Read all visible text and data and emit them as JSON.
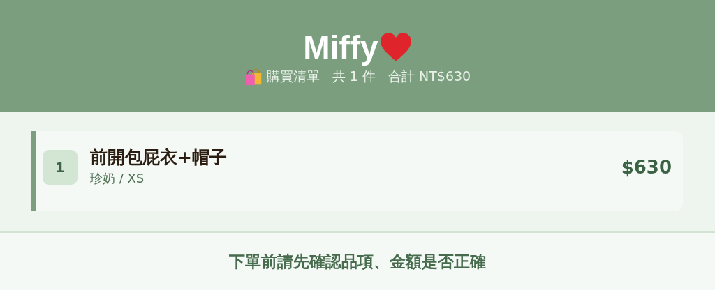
{
  "header": {
    "title": "Miffy",
    "list_label": "購買清單",
    "count": "共 1 件",
    "total": "合計 NT$630"
  },
  "items": [
    {
      "index": "1",
      "name": "前開包屁衣+帽子",
      "variant": "珍奶 / XS",
      "price": "$630"
    }
  ],
  "footer": {
    "note": "下單前請先確認品項、金額是否正確"
  }
}
